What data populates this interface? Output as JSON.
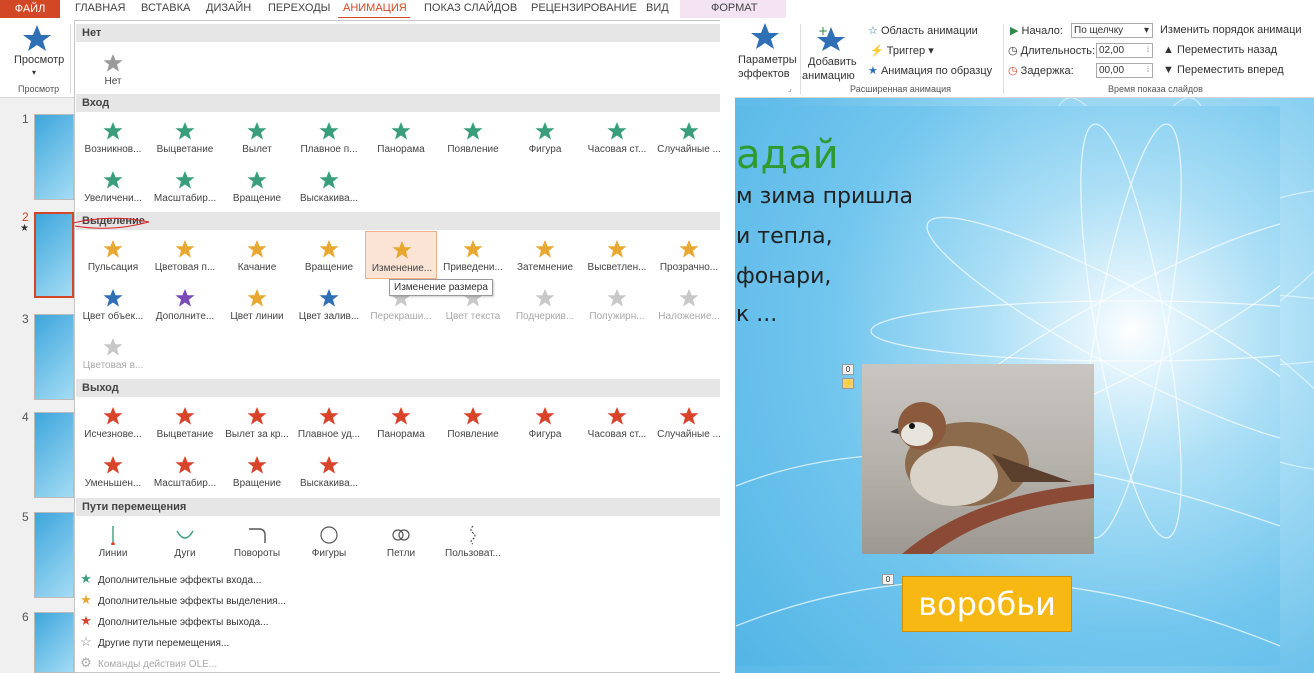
{
  "tabs": [
    "ФАЙЛ",
    "ГЛАВНАЯ",
    "ВСТАВКА",
    "ДИЗАЙН",
    "ПЕРЕХОДЫ",
    "АНИМАЦИЯ",
    "ПОКАЗ СЛАЙДОВ",
    "РЕЦЕНЗИРОВАНИЕ",
    "ВИД",
    "ФОРМАТ"
  ],
  "active_tab": "АНИМАЦИЯ",
  "ribbon": {
    "preview_label": "Просмотр",
    "preview_group": "Просмотр",
    "effect_params": "Параметры",
    "effect_params2": "эффектов",
    "add_anim": "Добавить",
    "add_anim2": "анимацию",
    "anim_pane": "Область анимации",
    "trigger": "Триггер",
    "anim_painter": "Анимация по образцу",
    "adv_group": "Расширенная анимация",
    "start_label": "Начало:",
    "start_value": "По щелчку",
    "duration_label": "Длительность:",
    "duration_value": "02,00",
    "delay_label": "Задержка:",
    "delay_value": "00,00",
    "reorder": "Изменить порядок анимаци",
    "move_back": "Переместить назад",
    "move_fwd": "Переместить вперед",
    "timing_group": "Время показа слайдов"
  },
  "slide_numbers": [
    "1",
    "2",
    "3",
    "4",
    "5",
    "6"
  ],
  "slide": {
    "title": "адай",
    "lines": [
      "м зима пришла",
      "и тепла,",
      "фонари,",
      "к ..."
    ],
    "answer": "воробьи",
    "marker_a": "0",
    "marker_b": "0"
  },
  "gallery": {
    "sec_none": "Нет",
    "none_label": "Нет",
    "sec_entry": "Вход",
    "entry": [
      "Возникнов...",
      "Выцветание",
      "Вылет",
      "Плавное п...",
      "Панорама",
      "Появление",
      "Фигура",
      "Часовая ст...",
      "Случайные ...",
      "Увеличени...",
      "Масштабир...",
      "Вращение",
      "Выскакива..."
    ],
    "sec_emphasis": "Выделение",
    "emphasis": [
      "Пульсация",
      "Цветовая п...",
      "Качание",
      "Вращение",
      "Изменение...",
      "Приведени...",
      "Затемнение",
      "Высветлен...",
      "Прозрачно...",
      "Цвет объек...",
      "Дополните...",
      "Цвет линии",
      "Цвет залив...",
      "Перекраши...",
      "Цвет текста",
      "Подчеркив...",
      "Полужирн...",
      "Наложение...",
      "Цветовая в..."
    ],
    "sec_exit": "Выход",
    "exit": [
      "Исчезнове...",
      "Выцветание",
      "Вылет за кр...",
      "Плавное уд...",
      "Панорама",
      "Появление",
      "Фигура",
      "Часовая ст...",
      "Случайные ...",
      "Уменьшен...",
      "Масштабир...",
      "Вращение",
      "Выскакива..."
    ],
    "sec_paths": "Пути перемещения",
    "paths": [
      "Линии",
      "Дуги",
      "Повороты",
      "Фигуры",
      "Петли",
      "Пользоват..."
    ],
    "tooltip": "Изменение размера",
    "more": [
      "Дополнительные эффекты входа...",
      "Дополнительные эффекты выделения...",
      "Дополнительные эффекты выхода...",
      "Другие пути перемещения...",
      "Команды действия OLE..."
    ]
  },
  "colors": {
    "accent": "#d24726",
    "entry_star": "#3a9e7c",
    "emphasis_star": "#e8a830",
    "exit_star": "#d8432a",
    "ribbon_star": "#2f6fb5"
  },
  "icons": {
    "star": "star-icon",
    "arc": "arc-path-icon",
    "loop": "loop-path-icon",
    "circle": "shape-path-icon"
  }
}
